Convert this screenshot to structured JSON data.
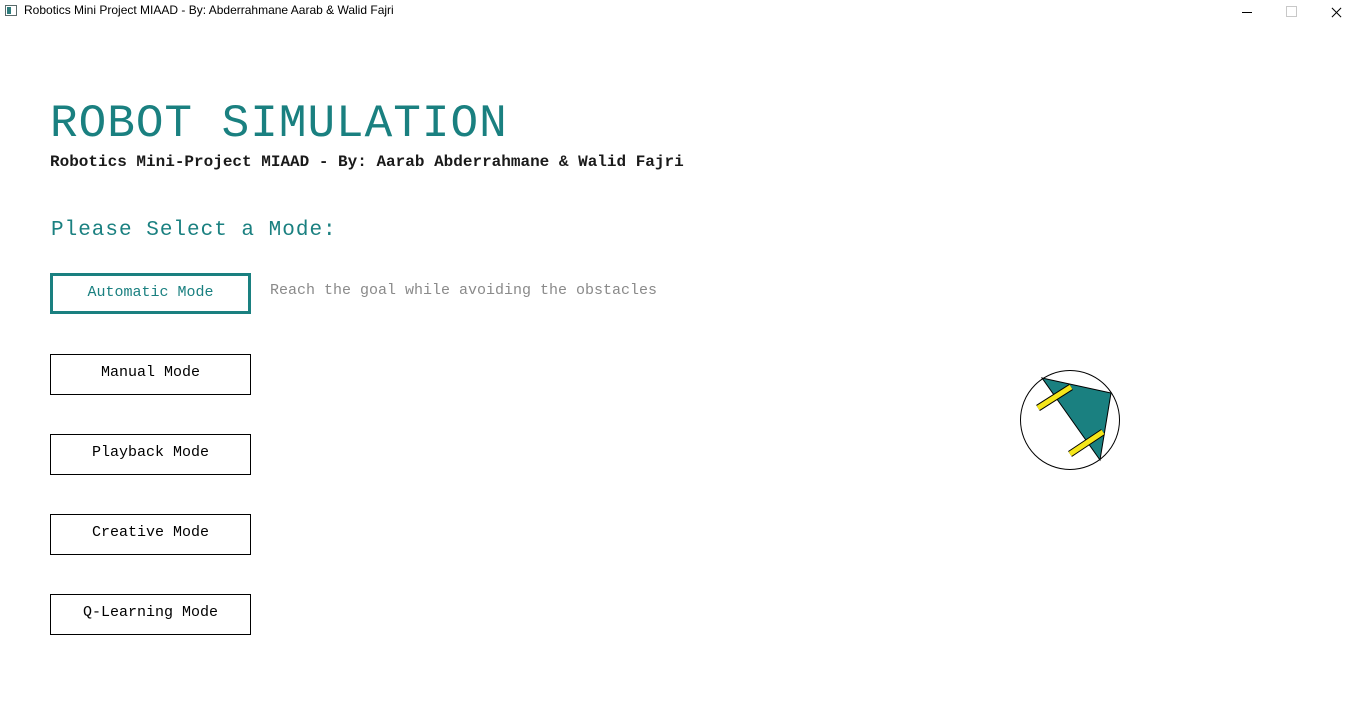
{
  "window": {
    "title": "Robotics Mini Project MIAAD - By: Abderrahmane Aarab & Walid Fajri",
    "icon": "app-window-icon",
    "controls": [
      "minimize-icon",
      "maximize-icon",
      "close-icon"
    ]
  },
  "header": {
    "title": "ROBOT SIMULATION",
    "subtitle": "Robotics Mini-Project MIAAD - By: Aarab Abderrahmane & Walid Fajri"
  },
  "menu": {
    "prompt": "Please Select a Mode:",
    "modes": [
      {
        "label": "Automatic Mode",
        "active": true,
        "description": "Reach the goal while avoiding the obstacles"
      },
      {
        "label": "Manual Mode",
        "active": false
      },
      {
        "label": "Playback Mode",
        "active": false
      },
      {
        "label": "Creative Mode",
        "active": false
      },
      {
        "label": "Q-Learning Mode",
        "active": false
      }
    ]
  },
  "robot": {
    "body_color": "#1a8080",
    "wheel_color": "#f5e61a",
    "outline_color": "#000000"
  },
  "colors": {
    "accent": "#1a8080",
    "description_text": "#8a8a8a"
  }
}
